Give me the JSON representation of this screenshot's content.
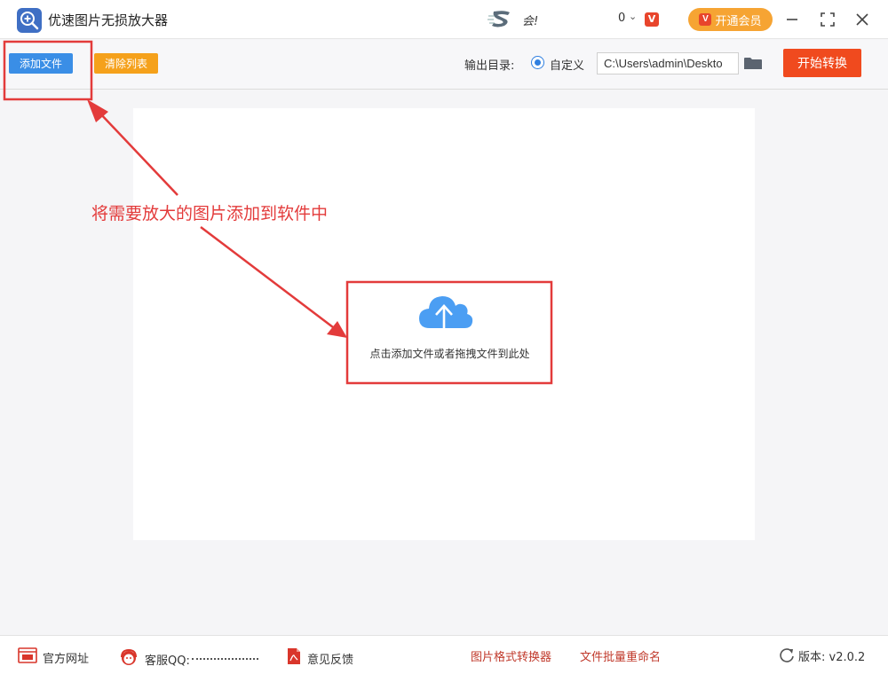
{
  "titlebar": {
    "app_title": "优速图片无损放大器",
    "user_name": "会!",
    "message_count": "0",
    "chevron": "⌄",
    "vip_label": "开通会员",
    "vip_icon_letter": "V"
  },
  "toolbar": {
    "add_file_label": "添加文件",
    "clear_list_label": "清除列表",
    "output_dir_label": "输出目录:",
    "radio_custom_label": "自定义",
    "output_path_value": "C:\\Users\\admin\\Deskto",
    "start_label": "开始转换"
  },
  "main": {
    "upload_hint": "点击添加文件或者拖拽文件到此处"
  },
  "annotation": {
    "text": "将需要放大的图片添加到软件中"
  },
  "footer": {
    "website_label": "官方网址",
    "support_qq_label": "客服QQ:",
    "feedback_label": "意见反馈",
    "format_converter_link": "图片格式转换器",
    "batch_rename_link": "文件批量重命名",
    "version_label": "版本:",
    "version_value": "v2.0.2"
  },
  "colors": {
    "accent_blue": "#3a8ee6",
    "accent_orange": "#f5a11b",
    "start_red": "#f04a1e",
    "annotation_red": "#e33b3b",
    "cloud_blue": "#4b9ef3"
  },
  "icons": [
    "app-logo-icon",
    "user-avatar-icon",
    "vip-icon",
    "minimize-icon",
    "maximize-icon",
    "close-icon",
    "folder-icon",
    "cloud-upload-icon",
    "website-icon",
    "support-icon",
    "feedback-icon",
    "refresh-icon"
  ]
}
